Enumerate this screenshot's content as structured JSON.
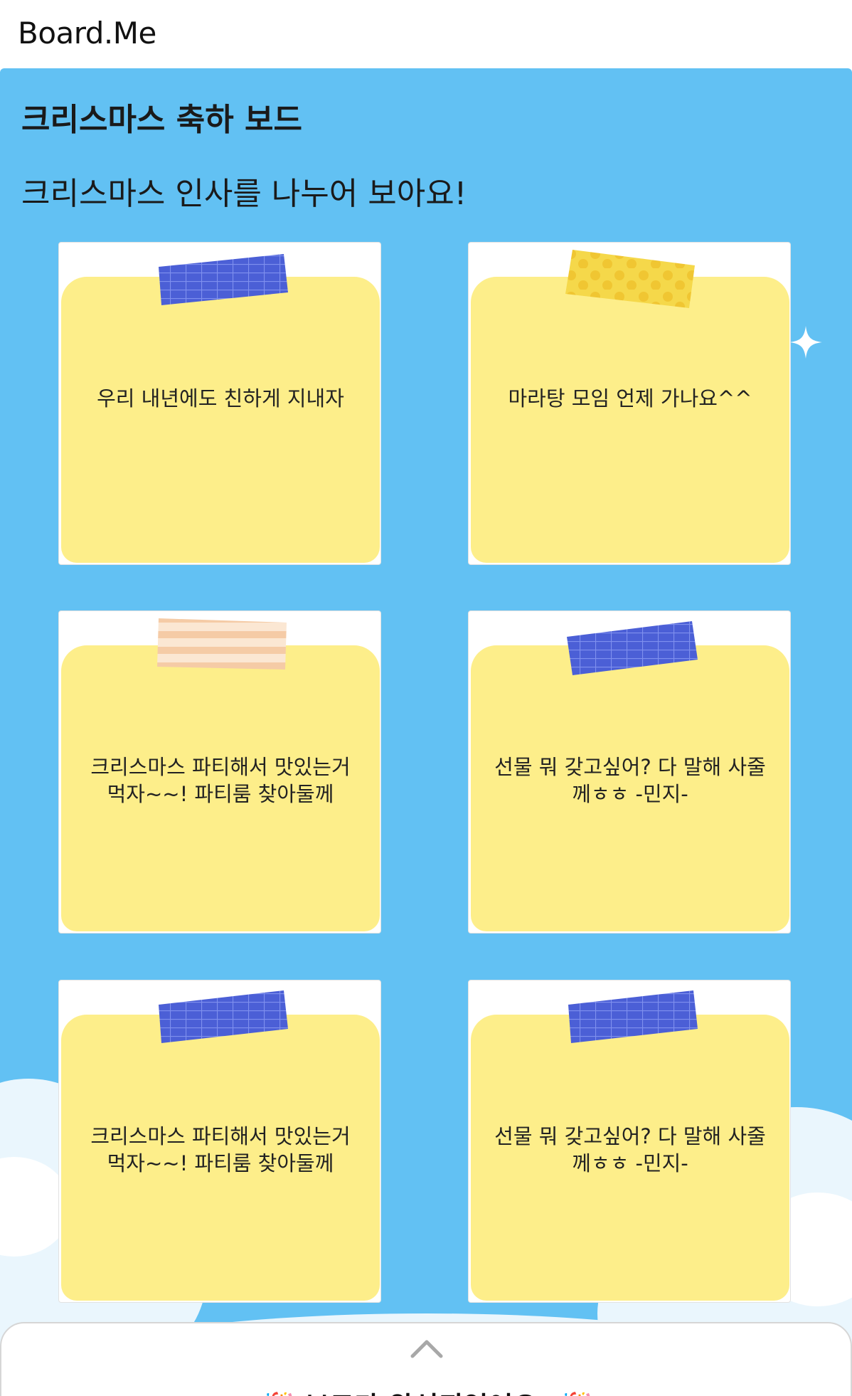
{
  "app": {
    "logo": "Board.Me"
  },
  "board": {
    "title": "크리스마스 축하 보드",
    "description": "크리스마스 인사를 나누어 보아요!",
    "background_color": "#62c1f3",
    "note_color": "#fdee8a",
    "cards": [
      {
        "message": "우리 내년에도 친하게 지내자",
        "tape": "blue-grid-tape"
      },
      {
        "message": "마라탕 모임 언제 가나요^^",
        "tape": "yellow-dot-tape"
      },
      {
        "message": "크리스마스 파티해서 맛있는거 먹자~~! 파티룸 찾아둘께",
        "tape": "peach-stripe-tape"
      },
      {
        "message": "선물 뭐 갖고싶어? 다 말해 사줄께ㅎㅎ -민지-",
        "tape": "blue-grid-tape"
      },
      {
        "message": "크리스마스 파티해서 맛있는거 먹자~~! 파티룸 찾아둘께",
        "tape": "blue-grid-tape"
      },
      {
        "message": "선물 뭐 갖고싶어? 다 말해 사줄께ㅎㅎ -민지-",
        "tape": "blue-grid-tape"
      }
    ]
  },
  "bottom_sheet": {
    "message": "🎉 보드가 완성되었어요! 🎉",
    "toggle_icon": "chevron-up-icon"
  }
}
